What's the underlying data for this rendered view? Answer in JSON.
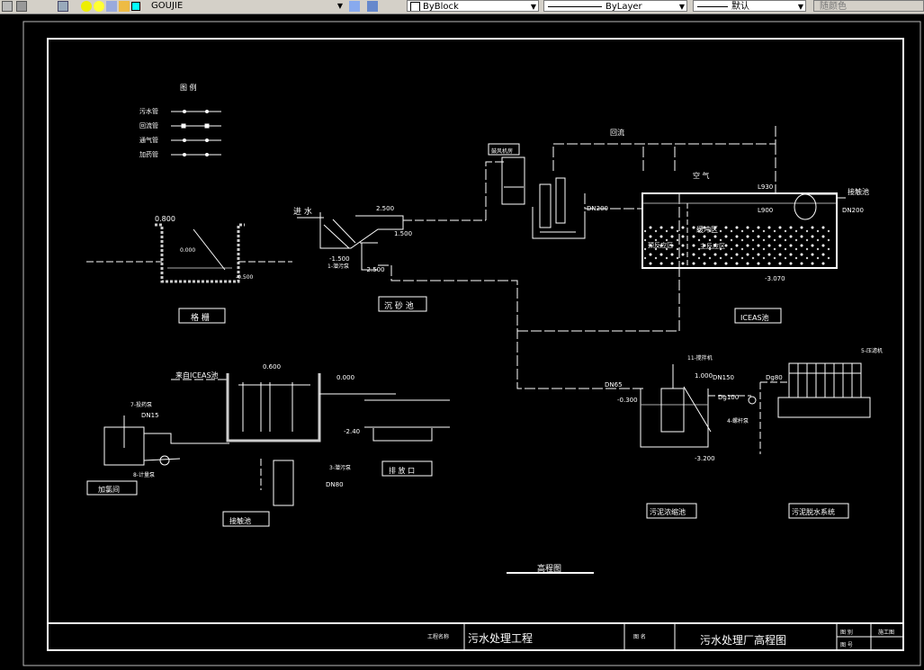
{
  "toolbar": {
    "layer_name": "GOUJIE",
    "color": "ByBlock",
    "linetype": "ByLayer",
    "lineweight": "默认",
    "plotstyle": "随颜色"
  },
  "legend": {
    "title": "图 例",
    "items": [
      "污水管",
      "回流管",
      "通气管",
      "加药管"
    ]
  },
  "labels": {
    "grille": "格 栅",
    "grit": "沉 砂 池",
    "iceas": "ICEAS池",
    "contact": "接触池",
    "dosing": "加氯间",
    "outlet": "排 放 口",
    "thickener": "污泥浓缩池",
    "dewater": "污泥脱水系统",
    "profile_title": "高程图",
    "inflow": "进 水",
    "from_iceas": "来自ICEAS池",
    "reflux": "回流",
    "air": "空 气",
    "to_contact": "接触池",
    "buffer": "缓冲区",
    "pre_react": "预反应区",
    "main_react": "主反应区",
    "active_sludge": "活性污泥",
    "pump_blower": "鼓风机房",
    "sludge_conc": "剩余污泥管"
  },
  "elevations": {
    "e1": "0.800",
    "e2": "0.000",
    "e3": "-1.500",
    "e4": "2.500",
    "e5": "1.500",
    "e6": "-1.500",
    "e7": "-2.500",
    "e8": "L930",
    "e9": "L900",
    "e10": "-3.070",
    "e11": "0.600",
    "e12": "0.000",
    "e13": "-2.40",
    "e14": "1.000",
    "e15": "-0.300",
    "e16": "-3.200",
    "e17": "-0.500"
  },
  "pipes": {
    "p1": "DN200",
    "p2": "DN150",
    "p3": "DN80",
    "p4": "DN200",
    "p5": "DN250",
    "p6": "DN15",
    "p7": "DN15",
    "p8": "DN200",
    "p9": "DN80",
    "p10": "DN65",
    "p11": "DN65",
    "p12": "DN150",
    "p13": "Dg100",
    "p14": "Dg80",
    "p15": "DN100",
    "p16": "DN200"
  },
  "equipment": {
    "q1": "1-潜污泵",
    "q2": "3-潜污泵",
    "q3": "7-投药泵",
    "q4": "8-计量泵",
    "q5": "11-搅拌机",
    "q6": "5-压滤机",
    "q7": "4-螺杆泵"
  },
  "title_block": {
    "label1": "工程名称",
    "project": "污水处理工程",
    "label2": "图  名",
    "drawing": "污水处理厂高程图",
    "label3": "图  别",
    "label4": "图  号",
    "label5": "施工图"
  }
}
